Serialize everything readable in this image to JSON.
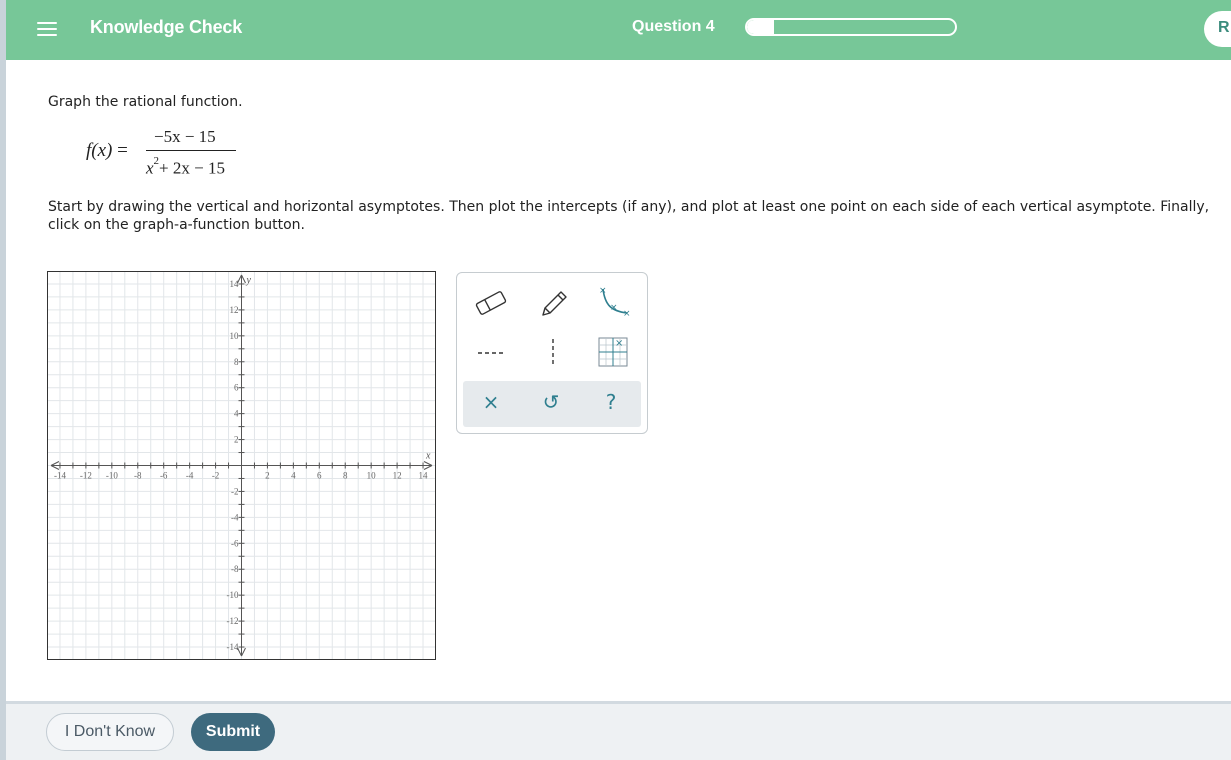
{
  "header": {
    "title": "Knowledge Check",
    "question_label": "Question 4",
    "progress": 0.13,
    "review_label": "R"
  },
  "problem": {
    "prompt": "Graph the rational function.",
    "formula": {
      "lhs": "f(x)",
      "equals": " =",
      "numerator": "−5x − 15",
      "denominator_base": "x",
      "denominator_exp": "2",
      "denominator_rest": "+ 2x − 15"
    },
    "instructions": "Start by drawing the vertical and horizontal asymptotes. Then plot the intercepts (if any), and plot at least one point on each side of each vertical asymptote. Finally, click on the graph-a-function button."
  },
  "graph": {
    "x_label": "x",
    "y_label": "y",
    "x_ticks": [
      "-14",
      "-12",
      "-10",
      "-8",
      "-6",
      "-4",
      "-2",
      "2",
      "4",
      "6",
      "8",
      "10",
      "12",
      "14"
    ],
    "y_ticks": [
      "14",
      "12",
      "10",
      "8",
      "6",
      "4",
      "2",
      "-2",
      "-4",
      "-6",
      "-8",
      "-10",
      "-12",
      "-14"
    ],
    "xlim": [
      -15,
      15
    ],
    "ylim": [
      -15,
      15
    ]
  },
  "toolbar": {
    "tools": [
      "eraser-icon",
      "pencil-icon",
      "rational-curve-icon",
      "horizontal-asymptote-icon",
      "vertical-asymptote-icon",
      "graph-function-icon"
    ],
    "actions": {
      "clear": "×",
      "undo": "↺",
      "help": "?"
    },
    "accent_color": "#2f7f8f"
  },
  "footer": {
    "idk_label": "I Don't Know",
    "submit_label": "Submit"
  },
  "colors": {
    "header_bg": "#77c798",
    "submit_bg": "#3e6a7e"
  }
}
